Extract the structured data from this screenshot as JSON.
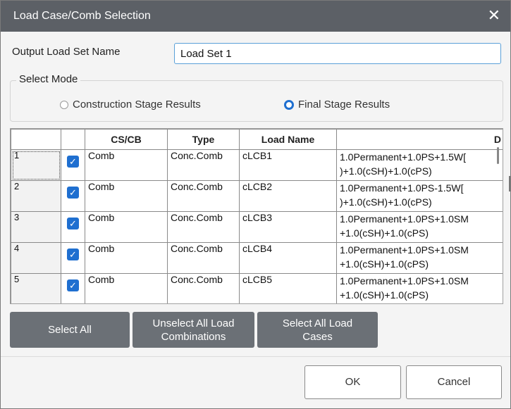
{
  "window": {
    "title": "Load Case/Comb Selection",
    "close_glyph": "✕"
  },
  "output": {
    "label": "Output Load Set Name",
    "value": "Load Set 1"
  },
  "select_mode": {
    "legend": "Select Mode",
    "options": [
      {
        "label": "Construction Stage Results",
        "selected": false
      },
      {
        "label": "Final Stage Results",
        "selected": true
      }
    ]
  },
  "grid": {
    "headers": [
      "",
      "",
      "CS/CB",
      "Type",
      "Load Name",
      "D"
    ],
    "rows": [
      {
        "num": "1",
        "checked": true,
        "cscb": "Comb",
        "type": "Conc.Comb",
        "name": "cLCB1",
        "desc": "1.0Permanent+1.0PS+1.5W[ )+1.0(cSH)+1.0(cPS)"
      },
      {
        "num": "2",
        "checked": true,
        "cscb": "Comb",
        "type": "Conc.Comb",
        "name": "cLCB2",
        "desc": "1.0Permanent+1.0PS-1.5W[ )+1.0(cSH)+1.0(cPS)"
      },
      {
        "num": "3",
        "checked": true,
        "cscb": "Comb",
        "type": "Conc.Comb",
        "name": "cLCB3",
        "desc": "1.0Permanent+1.0PS+1.0SM +1.0(cSH)+1.0(cPS)"
      },
      {
        "num": "4",
        "checked": true,
        "cscb": "Comb",
        "type": "Conc.Comb",
        "name": "cLCB4",
        "desc": "1.0Permanent+1.0PS+1.0SM +1.0(cSH)+1.0(cPS)"
      },
      {
        "num": "5",
        "checked": true,
        "cscb": "Comb",
        "type": "Conc.Comb",
        "name": "cLCB5",
        "desc": "1.0Permanent+1.0PS+1.0SM +1.0(cSH)+1.0(cPS)"
      }
    ]
  },
  "buttons": {
    "select_all": "Select All",
    "unselect_combos": "Unselect All Load Combinations",
    "select_cases": "Select All Load Cases",
    "ok": "OK",
    "cancel": "Cancel"
  },
  "icons": {
    "check": "check-icon",
    "close": "close-icon"
  },
  "colors": {
    "titlebar": "#5c6066",
    "accent": "#1f6fd0",
    "link": "#1a3fd8",
    "button": "#6b7076"
  }
}
